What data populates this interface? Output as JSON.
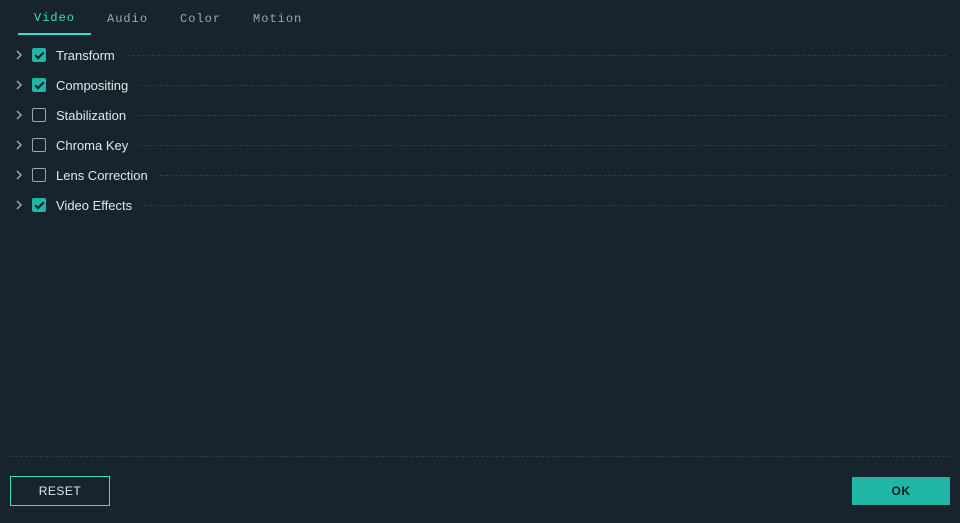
{
  "tabs": [
    {
      "label": "Video",
      "active": true
    },
    {
      "label": "Audio",
      "active": false
    },
    {
      "label": "Color",
      "active": false
    },
    {
      "label": "Motion",
      "active": false
    }
  ],
  "sections": [
    {
      "label": "Transform",
      "checked": true
    },
    {
      "label": "Compositing",
      "checked": true
    },
    {
      "label": "Stabilization",
      "checked": false
    },
    {
      "label": "Chroma Key",
      "checked": false
    },
    {
      "label": "Lens Correction",
      "checked": false
    },
    {
      "label": "Video Effects",
      "checked": true
    }
  ],
  "footer": {
    "reset_label": "RESET",
    "ok_label": "OK"
  },
  "colors": {
    "accent": "#37e0c8",
    "accent_fill": "#1fb6a5",
    "background": "#17242d"
  }
}
